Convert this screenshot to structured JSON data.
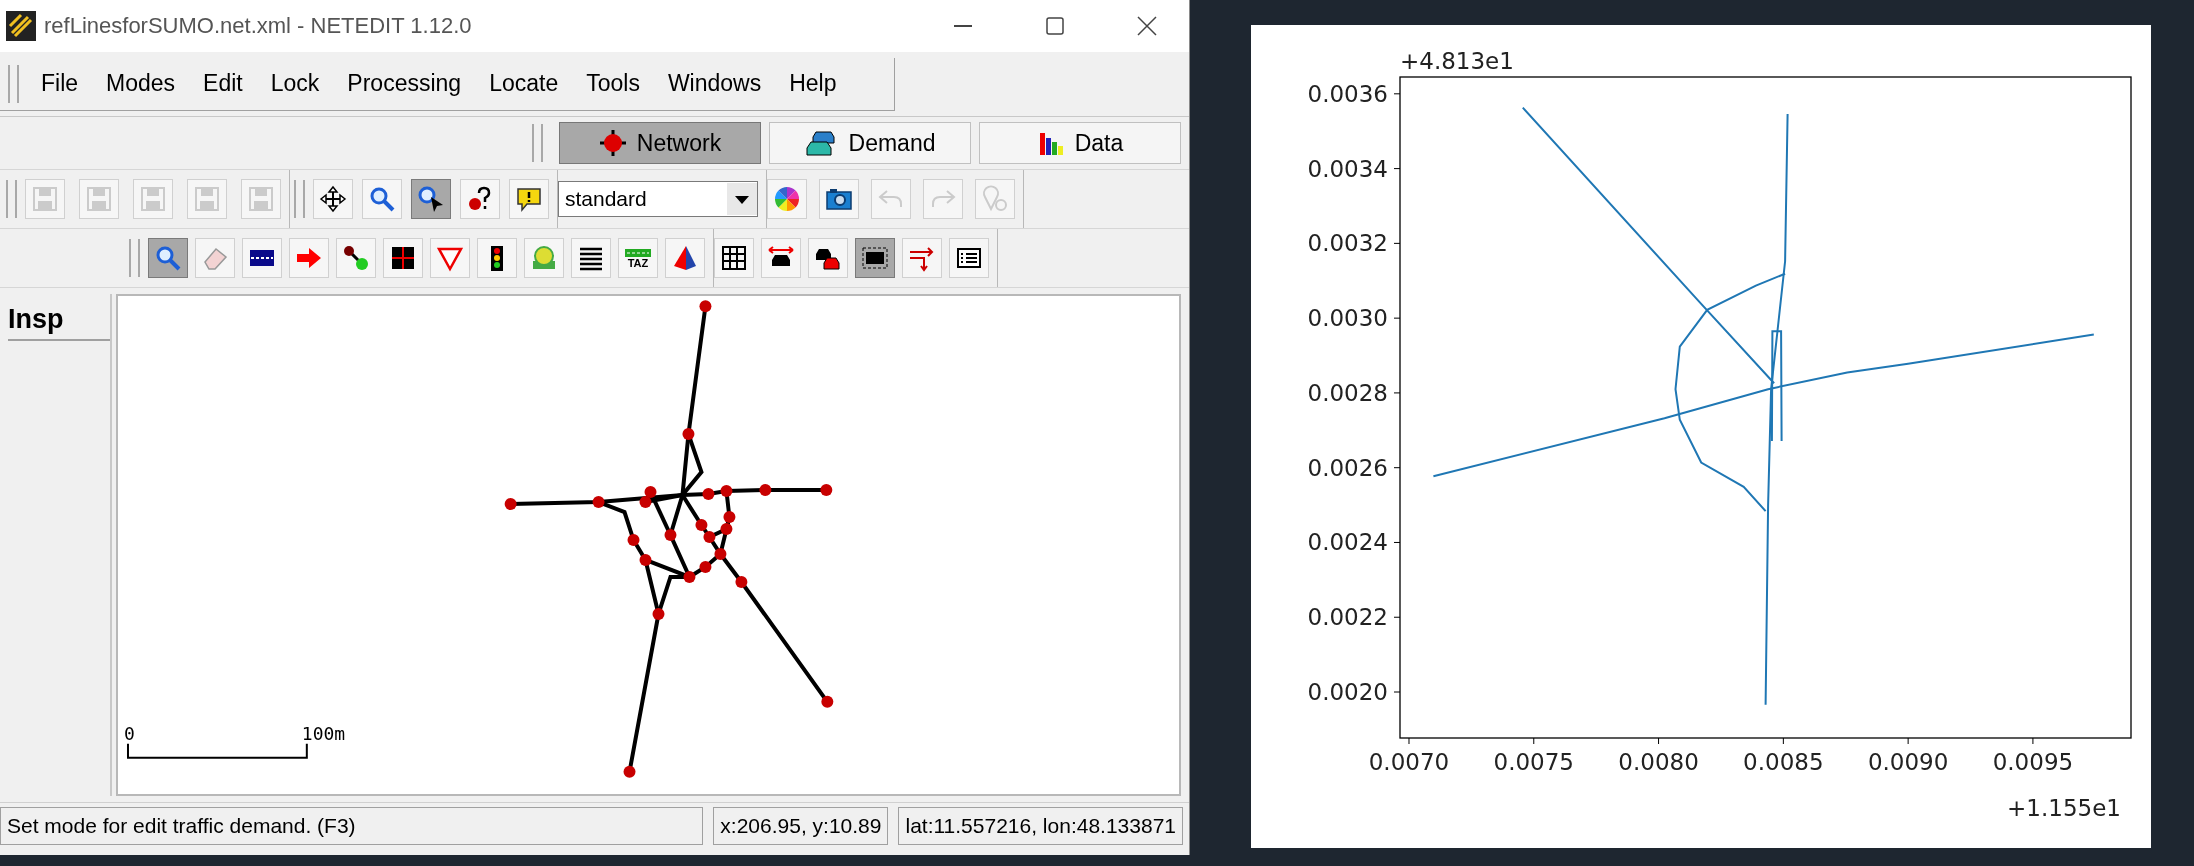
{
  "window": {
    "title": "refLinesforSUMO.net.xml - NETEDIT 1.12.0"
  },
  "menu": [
    "File",
    "Modes",
    "Edit",
    "Lock",
    "Processing",
    "Locate",
    "Tools",
    "Windows",
    "Help"
  ],
  "supermodes": [
    {
      "kind": "network",
      "label": "Network",
      "selected": true
    },
    {
      "kind": "demand",
      "label": "Demand",
      "selected": false
    },
    {
      "kind": "data",
      "label": "Data",
      "selected": false
    }
  ],
  "toolbar_file": [
    {
      "kind": "save",
      "disabled": true
    },
    {
      "kind": "save",
      "disabled": true
    },
    {
      "kind": "save",
      "disabled": true
    },
    {
      "kind": "save",
      "disabled": true
    },
    {
      "kind": "save",
      "disabled": true
    }
  ],
  "toolbar_view": [
    {
      "kind": "move",
      "selected": false
    },
    {
      "kind": "zoom",
      "selected": false
    },
    {
      "kind": "select",
      "selected": true
    },
    {
      "kind": "help",
      "selected": false
    },
    {
      "kind": "comment",
      "selected": false
    }
  ],
  "scheme": {
    "value": "standard"
  },
  "toolbar_misc": [
    {
      "kind": "palette",
      "disabled": false
    },
    {
      "kind": "camera",
      "disabled": false
    },
    {
      "kind": "undo",
      "disabled": true
    },
    {
      "kind": "redo",
      "disabled": true
    },
    {
      "kind": "locate",
      "disabled": true
    }
  ],
  "toolbar_modes": [
    {
      "kind": "inspect",
      "selected": true
    },
    {
      "kind": "delete",
      "selected": false
    },
    {
      "kind": "lane",
      "selected": false
    },
    {
      "kind": "arrow",
      "selected": false
    },
    {
      "kind": "connect",
      "selected": false
    },
    {
      "kind": "crossing",
      "selected": false
    },
    {
      "kind": "yield",
      "selected": false
    },
    {
      "kind": "tls",
      "selected": false
    },
    {
      "kind": "stop",
      "selected": false
    },
    {
      "kind": "lines",
      "selected": false
    },
    {
      "kind": "taz",
      "label": "TAZ",
      "selected": false
    },
    {
      "kind": "shape",
      "selected": false
    }
  ],
  "toolbar_options": [
    {
      "kind": "grid",
      "selected": false
    },
    {
      "kind": "width",
      "selected": false
    },
    {
      "kind": "cars",
      "selected": false
    },
    {
      "kind": "frame",
      "selected": true
    },
    {
      "kind": "split",
      "selected": false
    },
    {
      "kind": "list",
      "selected": false
    }
  ],
  "side_panel": {
    "title": "Insp"
  },
  "canvas": {
    "scale_labels": [
      "0",
      "100m"
    ]
  },
  "status_bar": {
    "message": "Set mode for edit traffic demand. (F3)",
    "position": "x:206.95, y:10.89",
    "geo": "lat:11.557216, lon:48.133871"
  },
  "plot": {
    "chart_data": {
      "type": "line",
      "xlim": [
        0.006964,
        0.009893
      ],
      "ylim": [
        0.001877,
        0.003645
      ],
      "orientation": "vertical",
      "xticks": [
        {
          "value": 0.007,
          "label": "0.0070"
        },
        {
          "value": 0.0075,
          "label": "0.0075"
        },
        {
          "value": 0.008,
          "label": "0.0080"
        },
        {
          "value": 0.0085,
          "label": "0.0085"
        },
        {
          "value": 0.009,
          "label": "0.0090"
        },
        {
          "value": 0.0095,
          "label": "0.0095"
        }
      ],
      "yticks": [
        {
          "value": 0.002,
          "label": "0.0020"
        },
        {
          "value": 0.0022,
          "label": "0.0022"
        },
        {
          "value": 0.0024,
          "label": "0.0024"
        },
        {
          "value": 0.0026,
          "label": "0.0026"
        },
        {
          "value": 0.0028,
          "label": "0.0028"
        },
        {
          "value": 0.003,
          "label": "0.0030"
        },
        {
          "value": 0.0032,
          "label": "0.0032"
        },
        {
          "value": 0.0034,
          "label": "0.0034"
        },
        {
          "value": 0.0036,
          "label": "0.0036"
        }
      ],
      "series": [
        {
          "color": "#1f77b4",
          "x": [
            0.007098,
            0.008024,
            0.008439,
            0.008756,
            0.009,
            0.009744
          ],
          "values": [
            0.002577,
            0.002732,
            0.00281,
            0.002855,
            0.002878,
            0.002956
          ]
        },
        {
          "color": "#1f77b4",
          "x": [
            0.007456,
            0.008171,
            0.008463
          ],
          "values": [
            0.003563,
            0.003038,
            0.002826
          ]
        },
        {
          "color": "#1f77b4",
          "x": [
            0.008429,
            0.008439,
            0.008451,
            0.008507,
            0.008517
          ],
          "values": [
            0.001966,
            0.0025,
            0.00281,
            0.003152,
            0.003546
          ]
        },
        {
          "color": "#1f77b4",
          "x": [
            0.008507,
            0.00839,
            0.008195,
            0.008085,
            0.008068,
            0.008085,
            0.008171,
            0.008341,
            0.008429
          ],
          "values": [
            0.003119,
            0.003087,
            0.003022,
            0.002924,
            0.00281,
            0.002728,
            0.002614,
            0.002549,
            0.002484
          ]
        },
        {
          "color": "#1f77b4",
          "x": [
            0.008454,
            0.008456,
            0.008491,
            0.008493
          ],
          "values": [
            0.002671,
            0.002965,
            0.002965,
            0.002671
          ]
        }
      ]
    },
    "y_offset": "+4.813e1",
    "x_offset": "+1.155e1"
  }
}
